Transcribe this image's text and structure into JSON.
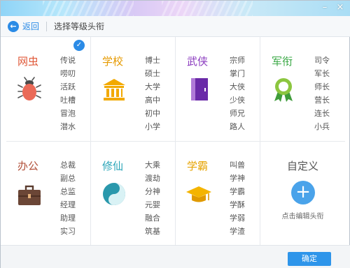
{
  "window": {
    "controls": {
      "minimize": "–",
      "close": "×"
    }
  },
  "navbar": {
    "back_icon": "←",
    "back_label": "返回",
    "title": "选择等级头衔"
  },
  "categories": [
    {
      "name": "网虫",
      "color": "#e05a3a",
      "icon": "bug-icon",
      "ranks": [
        "传说",
        "唠叨",
        "活跃",
        "吐槽",
        "冒泡",
        "潜水"
      ],
      "selected": true
    },
    {
      "name": "学校",
      "color": "#e69a00",
      "icon": "school-building-icon",
      "ranks": [
        "博士",
        "硕士",
        "大学",
        "高中",
        "初中",
        "小学"
      ],
      "selected": false
    },
    {
      "name": "武侠",
      "color": "#8b3bbf",
      "icon": "martial-arts-book-icon",
      "ranks": [
        "宗师",
        "掌门",
        "大侠",
        "少侠",
        "师兄",
        "路人"
      ],
      "selected": false
    },
    {
      "name": "军衔",
      "color": "#3aa845",
      "icon": "military-medal-icon",
      "ranks": [
        "司令",
        "军长",
        "师长",
        "营长",
        "连长",
        "小兵"
      ],
      "selected": false
    },
    {
      "name": "办公",
      "color": "#b2513a",
      "icon": "briefcase-icon",
      "ranks": [
        "总裁",
        "副总",
        "总监",
        "经理",
        "助理",
        "实习"
      ],
      "selected": false
    },
    {
      "name": "修仙",
      "color": "#2aa5b8",
      "icon": "yin-yang-icon",
      "ranks": [
        "大乘",
        "渡劫",
        "分神",
        "元婴",
        "融合",
        "筑基"
      ],
      "selected": false
    },
    {
      "name": "学霸",
      "color": "#e6a300",
      "icon": "graduation-cap-icon",
      "ranks": [
        "叫兽",
        "学神",
        "学霸",
        "学酥",
        "学弱",
        "学渣"
      ],
      "selected": false
    }
  ],
  "selected_mark": "✓",
  "custom": {
    "label": "自定义",
    "plus_icon": "+",
    "hint": "点击编辑头衔"
  },
  "footer": {
    "ok_label": "确定"
  }
}
